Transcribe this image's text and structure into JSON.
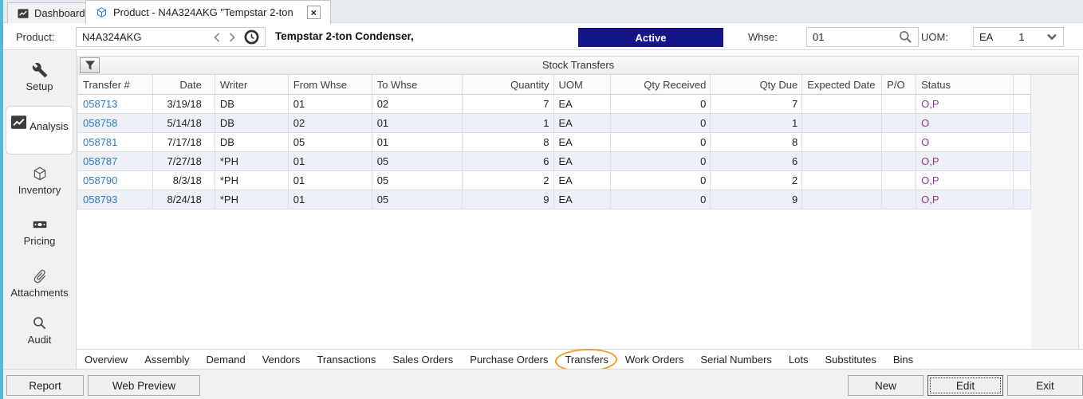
{
  "top_tabs": {
    "dashboard": "Dashboard",
    "product": "Product - N4A324AKG \"Tempstar 2-ton",
    "close": "×"
  },
  "product_bar": {
    "product_label": "Product:",
    "product_value": "N4A324AKG",
    "description": "Tempstar 2-ton Condenser,",
    "status_badge": "Active",
    "whse_label": "Whse:",
    "whse_value": "01",
    "uom_label": "UOM:",
    "uom_value": "EA",
    "uom_factor": "1"
  },
  "sidebar": {
    "items": [
      {
        "label": "Setup",
        "icon": "wrench-icon"
      },
      {
        "label": "Analysis",
        "icon": "chart-icon",
        "selected": true
      },
      {
        "label": "Inventory",
        "icon": "cube-icon"
      },
      {
        "label": "Pricing",
        "icon": "banknote-icon"
      },
      {
        "label": "Attachments",
        "icon": "paperclip-icon"
      },
      {
        "label": "Audit",
        "icon": "magnifier-icon"
      }
    ]
  },
  "transfers_table": {
    "title": "Stock Transfers",
    "columns": [
      "Transfer #",
      "Date",
      "Writer",
      "From Whse",
      "To Whse",
      "Quantity",
      "UOM",
      "Qty Received",
      "Qty Due",
      "Expected Date",
      "P/O",
      "Status"
    ],
    "rows": [
      [
        "058713",
        "3/19/18",
        "DB",
        "01",
        "02",
        "7",
        "EA",
        "0",
        "7",
        "",
        "",
        "O,P"
      ],
      [
        "058758",
        "5/14/18",
        "DB",
        "02",
        "01",
        "1",
        "EA",
        "0",
        "1",
        "",
        "",
        "O"
      ],
      [
        "058781",
        "7/17/18",
        "DB",
        "05",
        "01",
        "8",
        "EA",
        "0",
        "8",
        "",
        "",
        "O"
      ],
      [
        "058787",
        "7/27/18",
        "*PH",
        "01",
        "05",
        "6",
        "EA",
        "0",
        "6",
        "",
        "",
        "O,P"
      ],
      [
        "058790",
        "8/3/18",
        "*PH",
        "01",
        "05",
        "2",
        "EA",
        "0",
        "2",
        "",
        "",
        "O,P"
      ],
      [
        "058793",
        "8/24/18",
        "*PH",
        "01",
        "05",
        "9",
        "EA",
        "0",
        "9",
        "",
        "",
        "O,P"
      ]
    ]
  },
  "bottom_tabs": {
    "items": [
      "Overview",
      "Assembly",
      "Demand",
      "Vendors",
      "Transactions",
      "Sales Orders",
      "Purchase Orders",
      "Transfers",
      "Work Orders",
      "Serial Numbers",
      "Lots",
      "Substitutes",
      "Bins"
    ],
    "annotated": "Transfers"
  },
  "footer": {
    "report": "Report",
    "web_preview": "Web Preview",
    "new": "New",
    "edit": "Edit",
    "exit": "Exit"
  },
  "colors": {
    "accent_stripe": "#55b8da",
    "active_badge_bg": "#151587",
    "link_blue": "#3379bd",
    "status_purple": "#993399",
    "annotation_orange": "#eb9c34"
  }
}
